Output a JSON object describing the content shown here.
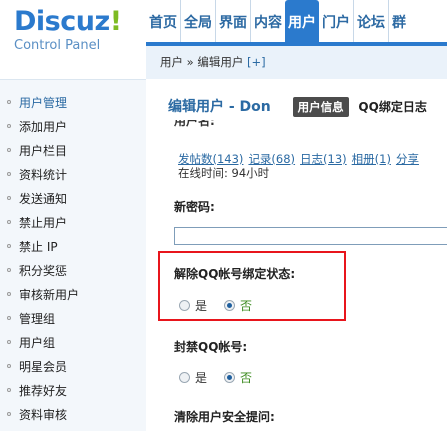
{
  "logo": {
    "main": "Discuz",
    "bang": "!",
    "sub": "Control Panel"
  },
  "nav": [
    "首页",
    "全局",
    "界面",
    "内容",
    "用户",
    "门户",
    "论坛",
    "群"
  ],
  "breadcrumb": {
    "text": "用户 » 编辑用户",
    "plus": "[+]"
  },
  "sidebar": [
    "用户管理",
    "添加用户",
    "用户栏目",
    "资料统计",
    "发送通知",
    "禁止用户",
    "禁止 IP",
    "积分奖惩",
    "审核新用户",
    "管理组",
    "用户组",
    "明星会员",
    "推荐好友",
    "资料审核"
  ],
  "page": {
    "title": "编辑用户 - Don",
    "tab_userinfo": "用户信息",
    "tab_qq": "QQ绑定日志",
    "clipped_label": "用户名:",
    "stats": [
      "发帖数(143)",
      "记录(68)",
      "日志(13)",
      "相册(1)",
      "分享"
    ],
    "online": "在线时间: 94小时",
    "new_password_label": "新密码:",
    "qq_unbind_label": "解除QQ帐号绑定状态:",
    "qq_ban_label": "封禁QQ帐号:",
    "security_label": "清除用户安全提问:",
    "yes": "是",
    "no": "否"
  }
}
